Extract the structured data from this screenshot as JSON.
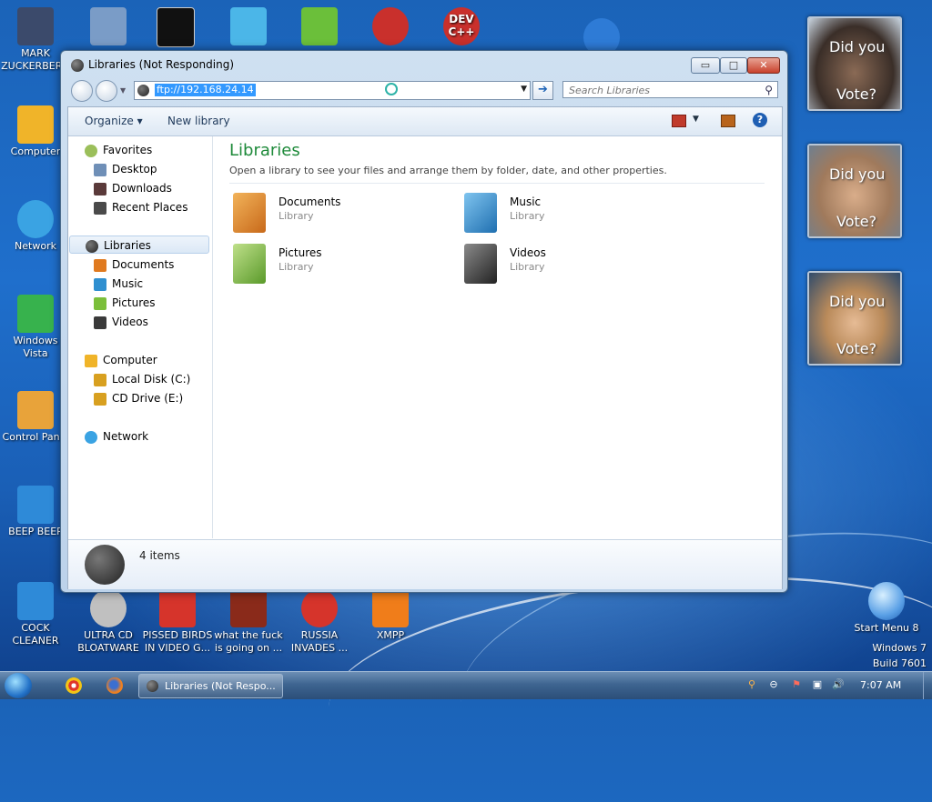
{
  "window": {
    "title": "Libraries (Not Responding)",
    "min_glyph": "▭",
    "max_glyph": "□",
    "close_glyph": "✕",
    "address": "ftp://192.168.24.14",
    "search_placeholder": "Search Libraries",
    "search_glyph": "⚲",
    "go_glyph": "➔",
    "dropdown_glyph": "▼"
  },
  "toolbar": {
    "organize": "Organize ▾",
    "new_library": "New library",
    "view_dropdown": "▼",
    "help": "?"
  },
  "nav": {
    "favorites": "Favorites",
    "desktop": "Desktop",
    "downloads": "Downloads",
    "recent_places": "Recent Places",
    "libraries": "Libraries",
    "documents": "Documents",
    "music": "Music",
    "pictures": "Pictures",
    "videos": "Videos",
    "computer": "Computer",
    "local_disk": "Local Disk (C:)",
    "cd_drive": "CD Drive (E:)",
    "network": "Network"
  },
  "main": {
    "heading": "Libraries",
    "subtitle": "Open a library to see your files and arrange them by folder, date, and other properties.",
    "libraries": [
      {
        "name": "Documents",
        "type": "Library",
        "color": "#e07a1f"
      },
      {
        "name": "Music",
        "type": "Library",
        "color": "#2f8fd0"
      },
      {
        "name": "Pictures",
        "type": "Library",
        "color": "#7bbf3a"
      },
      {
        "name": "Videos",
        "type": "Library",
        "color": "#3a3a3a"
      }
    ]
  },
  "details": {
    "count": "4 items"
  },
  "desktop": {
    "left_icons": [
      {
        "label": "MARK\nZUCKERBERG",
        "color": "#3b4a6b"
      },
      {
        "label": "Computer",
        "color": "#f0b429"
      },
      {
        "label": "Network",
        "color": "#3aa3e3"
      },
      {
        "label": "Windows\nVista",
        "color": "#37b24d"
      },
      {
        "label": "Control Panel",
        "color": "#e8a33a"
      },
      {
        "label": "BEEP BEEP",
        "color": "#2e8ad8"
      },
      {
        "label": "COCK\nCLEANER",
        "color": "#2e8ad8"
      }
    ],
    "top_icons": [
      {
        "color": "#7a9cc7"
      },
      {
        "color": "#111111"
      },
      {
        "color": "#4bb6e8"
      },
      {
        "color": "#6bbf3a"
      },
      {
        "color": "#c9302c"
      },
      {
        "label": "DEV\nC++",
        "color": "#c9302c"
      },
      {
        "color": "#2e7bd6"
      }
    ],
    "bottom_icons": [
      {
        "label": "ULTRA CD\nBLOATWARE",
        "color": "#c0c0c0"
      },
      {
        "label": "PISSED BIRDS\nIN VIDEO G...",
        "color": "#d6342b"
      },
      {
        "label": "what the fuck\nis going on ...",
        "color": "#8a2a1a"
      },
      {
        "label": "RUSSIA\nINVADES ...",
        "color": "#d6342b"
      },
      {
        "label": "XMPP",
        "color": "#f07d1a"
      }
    ],
    "start_menu_8": {
      "label": "Start Menu 8",
      "color": "#5aa0e6"
    },
    "gadgets": [
      {
        "line1": "Did you",
        "line2": "Vote?",
        "color": "#6b5a4e"
      },
      {
        "line1": "Did you",
        "line2": "Vote?",
        "color": "#b08a6a"
      },
      {
        "line1": "Did you",
        "line2": "Vote?",
        "color": "#c99a6a"
      }
    ],
    "watermark": {
      "line1": "Windows 7",
      "line2": "Build 7601"
    }
  },
  "taskbar": {
    "task_label": "Libraries (Not Respo...",
    "time": "7:07 AM",
    "tray_search": "⚲",
    "tray_minus": "⊖",
    "tray_flag": "⚑",
    "tray_monitor": "▣",
    "tray_volume": "🔊"
  },
  "colors": {
    "accent": "#1e8a3a",
    "selection": "#3399ff",
    "close": "#c8412b"
  }
}
